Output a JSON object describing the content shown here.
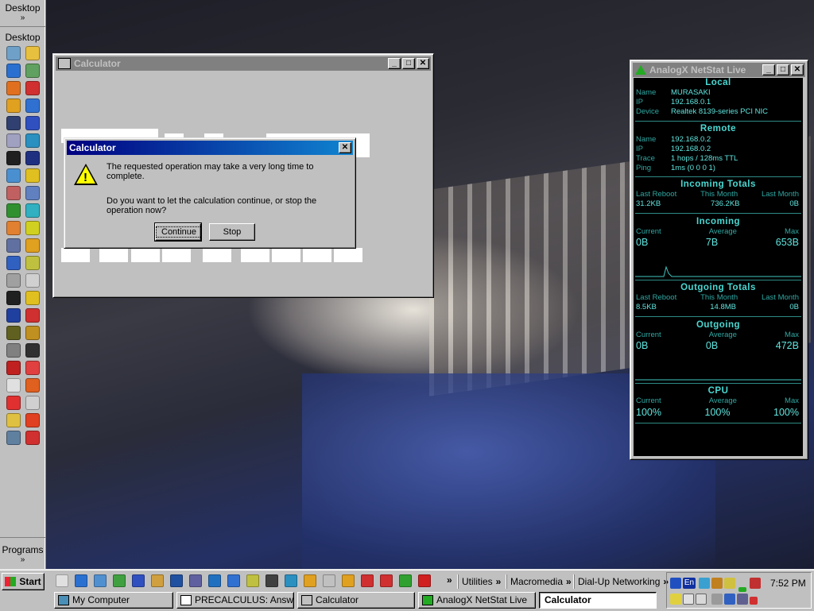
{
  "appbar": {
    "header_label": "Desktop",
    "header_chevron": "»",
    "section_label": "Desktop",
    "footer_label": "Programs",
    "footer_chevron": "»",
    "icons": [
      "my-computer-icon",
      "folder-icon",
      "internet-explorer-icon",
      "shield-icon",
      "media-player-icon",
      "acrobat-icon",
      "winamp-icon",
      "network-icon",
      "mail-icon",
      "messenger-icon",
      "printer-icon",
      "refresh-icon",
      "notepad-icon",
      "netscape-icon",
      "cd-icon",
      "globe-icon",
      "paint-icon",
      "find-icon",
      "gamepad-icon",
      "pencil-icon",
      "modem-icon",
      "chart-icon",
      "scanner-icon",
      "arrow-icon",
      "phone-icon",
      "settings-icon",
      "dos-icon",
      "jukebox-icon",
      "sound-icon",
      "trophy-icon",
      "flash-icon",
      "target-icon",
      "dreamweaver-icon",
      "fireworks-icon",
      "disk-icon",
      "undo-icon",
      "terminal-icon",
      "grid-icon",
      "number-icon",
      "palette-icon",
      "red-icon",
      "cube-icon",
      "book-icon",
      "pdf-icon",
      "tree-icon",
      "pdf2-icon"
    ]
  },
  "calculator_window": {
    "title": "Calculator",
    "minimize": "_",
    "maximize": "□",
    "close": "✕"
  },
  "dialog": {
    "title": "Calculator",
    "close": "✕",
    "icon": "warning-icon",
    "message1": "The requested operation may take a very long time to complete.",
    "message2": "Do you want to let the calculation continue, or stop the operation now?",
    "continue_label": "Continue",
    "stop_label": "Stop"
  },
  "netstat": {
    "title": "AnalogX NetStat Live",
    "local": {
      "title": "Local",
      "name_key": "Name",
      "name_val": "MURASAKI",
      "ip_key": "IP",
      "ip_val": "192.168.0.1",
      "device_key": "Device",
      "device_val": "Realtek 8139-series PCI NIC"
    },
    "remote": {
      "title": "Remote",
      "name_key": "Name",
      "name_val": "192.168.0.2",
      "ip_key": "IP",
      "ip_val": "192.168.0.2",
      "trace_key": "Trace",
      "trace_val": "1 hops / 128ms TTL",
      "ping_key": "Ping",
      "ping_val": "1ms (0 0 0 1)"
    },
    "incoming_totals": {
      "title": "Incoming Totals",
      "h1": "Last Reboot",
      "h2": "This Month",
      "h3": "Last Month",
      "v1": "31.2KB",
      "v2": "736.2KB",
      "v3": "0B"
    },
    "incoming": {
      "title": "Incoming",
      "h1": "Current",
      "h2": "Average",
      "h3": "Max",
      "v1": "0B",
      "v2": "7B",
      "v3": "653B"
    },
    "outgoing_totals": {
      "title": "Outgoing Totals",
      "h1": "Last Reboot",
      "h2": "This Month",
      "h3": "Last Month",
      "v1": "8.5KB",
      "v2": "14.8MB",
      "v3": "0B"
    },
    "outgoing": {
      "title": "Outgoing",
      "h1": "Current",
      "h2": "Average",
      "h3": "Max",
      "v1": "0B",
      "v2": "0B",
      "v3": "472B"
    },
    "cpu": {
      "title": "CPU",
      "h1": "Current",
      "h2": "Average",
      "h3": "Max",
      "v1": "100%",
      "v2": "100%",
      "v3": "100%"
    }
  },
  "taskbar": {
    "start_label": "Start",
    "toolbars": [
      {
        "label": "Utilities",
        "chevron": "»"
      },
      {
        "label": "Macromedia",
        "chevron": "»"
      },
      {
        "label": "Dial-Up Networking",
        "chevron": "»"
      }
    ],
    "quicklaunch_chevron": "»",
    "tasks": [
      {
        "label": "My Computer"
      },
      {
        "label": "PRECALCULUS: Answe..."
      },
      {
        "label": "Calculator"
      },
      {
        "label": "AnalogX NetStat Live"
      },
      {
        "label": "Calculator"
      }
    ],
    "clock": "7:52 PM",
    "language": "En"
  }
}
